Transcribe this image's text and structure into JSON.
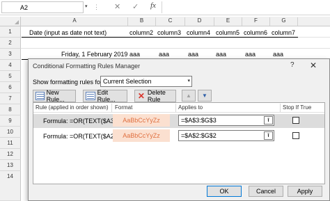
{
  "formula_bar": {
    "name_box": "A2",
    "dropdown_glyph": "▾",
    "separator": "⋮",
    "cancel_glyph": "✕",
    "enter_glyph": "✓",
    "fx_label": "fx"
  },
  "columns": {
    "letters": [
      "A",
      "B",
      "C",
      "D",
      "E",
      "F",
      "G"
    ]
  },
  "rows": {
    "numbers": [
      "1",
      "2",
      "3",
      "4",
      "5",
      "6",
      "7",
      "8",
      "9",
      "10",
      "11",
      "12",
      "13",
      "14"
    ]
  },
  "sheet": {
    "row1": [
      "Date (input as date not text)",
      "column2",
      "column3",
      "column4",
      "column5",
      "column6",
      "column7"
    ],
    "row3_date": "Friday, 1 February 2019",
    "row3_values": [
      "aaa",
      "aaa",
      "aaa",
      "aaa",
      "aaa",
      "aaa"
    ]
  },
  "dialog": {
    "title": "Conditional Formatting Rules Manager",
    "help_glyph": "?",
    "close_glyph": "✕",
    "show_label": "Show formatting rules for:",
    "show_value": "Current Selection",
    "select_arrow": "▾",
    "new_rule": "New Rule...",
    "edit_rule": "Edit Rule...",
    "delete_rule": "Delete Rule",
    "delete_glyph": "✕",
    "move_up_glyph": "▲",
    "move_down_glyph": "▼",
    "headers": {
      "rule": "Rule (applied in order shown)",
      "format": "Format",
      "applies_to": "Applies to",
      "stop_if_true": "Stop If True"
    },
    "rules": [
      {
        "rule": "Formula: =OR(TEXT($A3...",
        "format_preview": "AaBbCcYyZz",
        "applies_to": "=$A$3:$G$3",
        "collapse_glyph": "⭱",
        "stop_if_true": false
      },
      {
        "rule": "Formula: =OR(TEXT($A2...",
        "format_preview": "AaBbCcYyZz",
        "applies_to": "=$A$2:$G$2",
        "collapse_glyph": "⭱",
        "stop_if_true": false
      }
    ],
    "ok_label": "OK",
    "cancel_label": "Cancel",
    "apply_label": "Apply"
  }
}
